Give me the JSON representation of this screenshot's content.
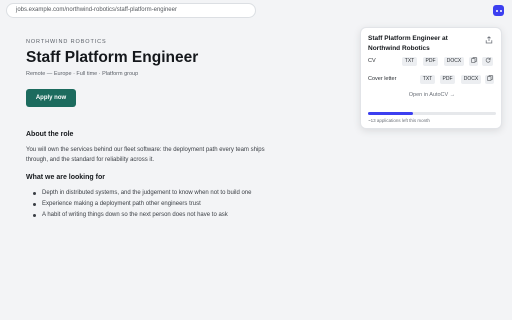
{
  "browser": {
    "url": "jobs.example.com/northwind-robotics/staff-platform-engineer",
    "extension_icon": "autocv-extension-icon"
  },
  "job": {
    "company": "NORTHWIND ROBOTICS",
    "title": "Staff Platform Engineer",
    "meta": "Remote — Europe · Full time · Platform group",
    "apply_label": "Apply now",
    "about_heading": "About the role",
    "about_text": "You will own the services behind our fleet software: the deployment path every team ships through, and the standard for reliability across it.",
    "looking_heading": "What we are looking for",
    "requirements": [
      "Depth in distributed systems, and the judgement to know when not to build one",
      "Experience making a deployment path other engineers trust",
      "A habit of writing things down so the next person does not have to ask"
    ]
  },
  "popup": {
    "title": "Staff Platform Engineer at Northwind Robotics",
    "share_icon": "share-icon",
    "cv_label": "CV",
    "cover_label": "Cover letter",
    "formats": [
      "TXT",
      "PDF",
      "DOCX"
    ],
    "copy_icon": "copy-icon",
    "regenerate_icon": "refresh-icon",
    "open_link": "Open in AutoCV →",
    "quota_fraction": 0.35,
    "quota_text": "~13 applications left this month",
    "accent": "#3c3ff0"
  }
}
